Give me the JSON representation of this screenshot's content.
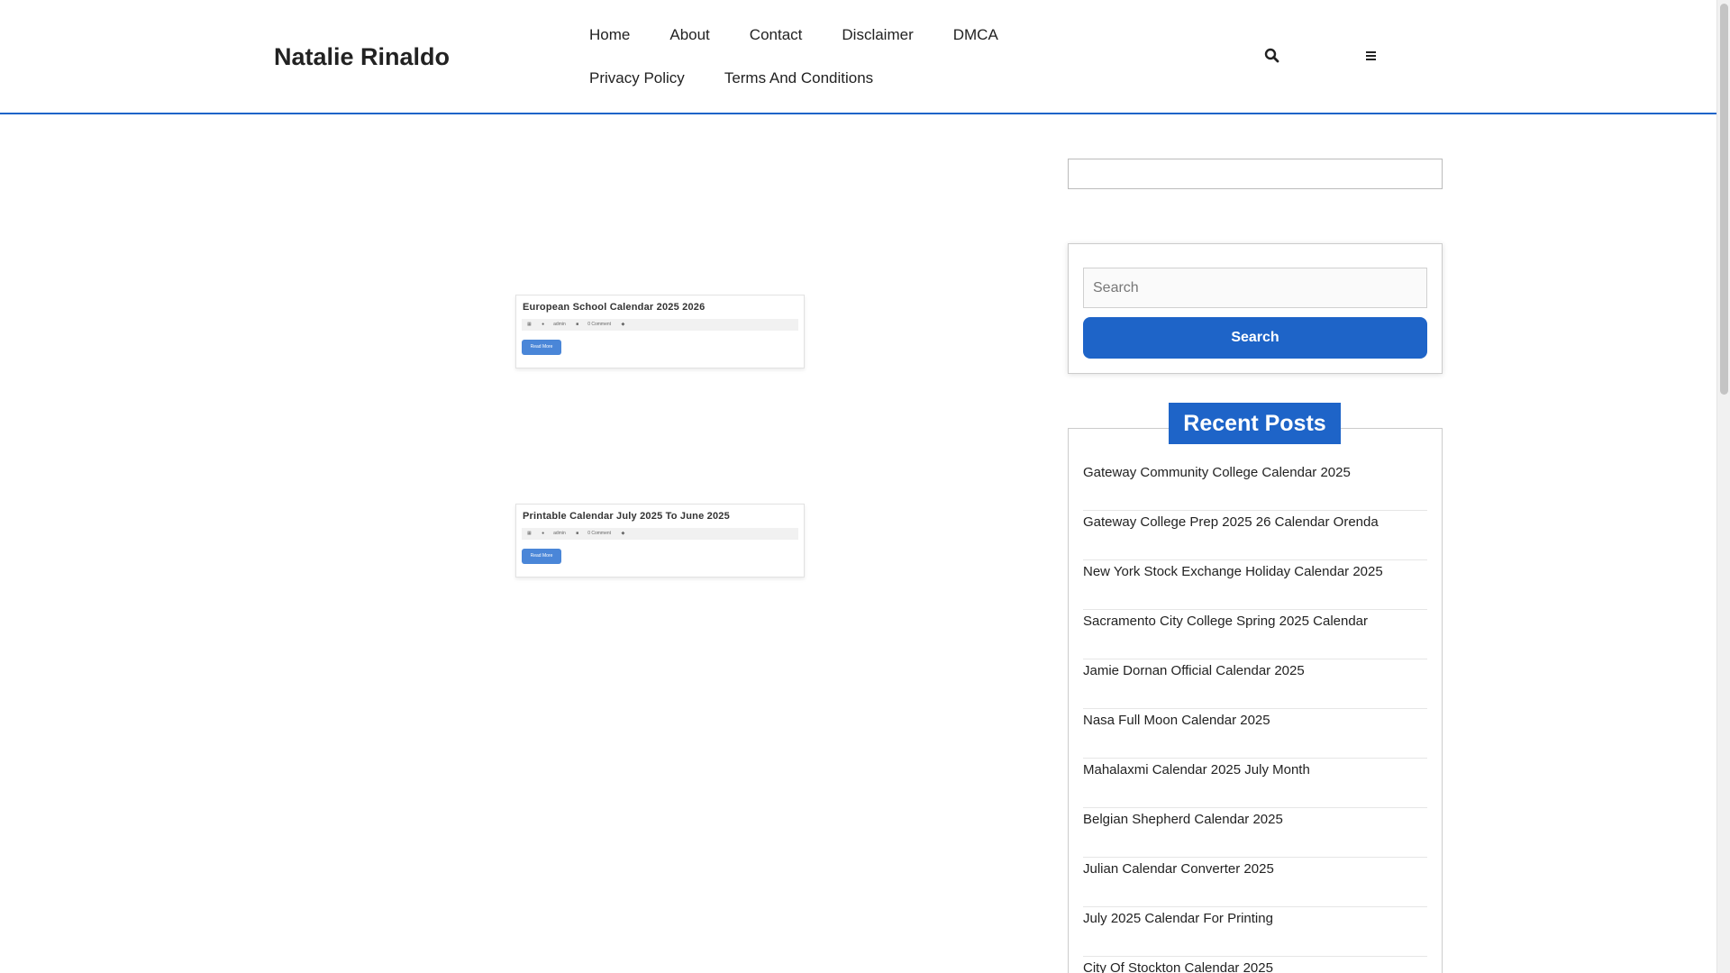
{
  "header": {
    "site_title": "Natalie Rinaldo",
    "nav": [
      "Home",
      "About",
      "Contact",
      "Disclaimer",
      "DMCA",
      "Privacy Policy",
      "Terms And Conditions"
    ]
  },
  "posts": [
    {
      "title": "European School Calendar 2025 2026",
      "meta_author": "admin",
      "meta_comments": "0 Comment",
      "read_more": "Read More"
    },
    {
      "title": "Printable Calendar July 2025 To June 2025",
      "meta_author": "admin",
      "meta_comments": "0 Comment",
      "read_more": "Read More"
    }
  ],
  "sidebar": {
    "search_placeholder": "Search",
    "search_button": "Search",
    "recent_heading": "Recent Posts",
    "recent_posts": [
      "Gateway Community College Calendar 2025",
      "Gateway College Prep 2025 26 Calendar Orenda",
      "New York Stock Exchange Holiday Calendar 2025",
      "Sacramento City College Spring 2025 Calendar",
      "Jamie Dornan Official Calendar 2025",
      "Nasa Full Moon Calendar 2025",
      "Mahalaxmi Calendar 2025 July Month",
      "Belgian Shepherd Calendar 2025",
      "Julian Calendar Converter 2025",
      "July 2025 Calendar For Printing",
      "City Of Stockton Calendar 2025"
    ]
  },
  "colors": {
    "accent": "#1e64c8"
  },
  "icons": {
    "header_search": "search-icon",
    "header_menu": "menu-icon"
  }
}
